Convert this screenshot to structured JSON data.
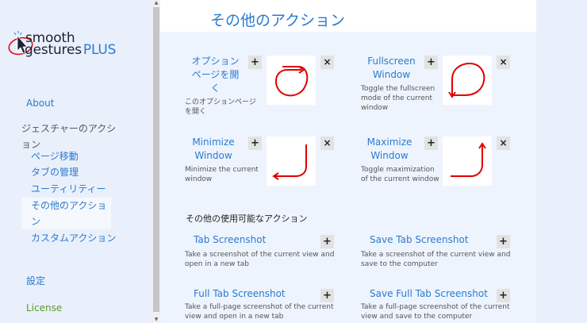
{
  "logo": {
    "line1": "smooth",
    "line2": "gestures",
    "plus": "PLUS"
  },
  "nav": {
    "about": "About",
    "gestures": "ジェスチャーのアクション",
    "sub": {
      "move": "ページ移動",
      "tabs": "タブの管理",
      "util": "ユーティリティー",
      "other": "その他のアクション",
      "custom": "カスタムアクション"
    },
    "settings": "設定",
    "license": "License"
  },
  "page": {
    "title": "その他のアクション"
  },
  "actions": {
    "options": {
      "label": "オプションページを開く",
      "desc": "このオプションページを開く",
      "add": "+",
      "remove": "×"
    },
    "fullscreen": {
      "label": "Fullscreen Window",
      "desc": "Toggle the fullscreen mode of the current window",
      "add": "+",
      "remove": "×"
    },
    "minimize": {
      "label": "Minimize Window",
      "desc": "Minimize the current window",
      "add": "+",
      "remove": "×"
    },
    "maximize": {
      "label": "Maximize Window",
      "desc": "Toggle maximization of the current window",
      "add": "+",
      "remove": "×"
    }
  },
  "available": {
    "title": "その他の使用可能なアクション",
    "items": [
      {
        "label": "Tab Screenshot",
        "desc": "Take a screenshot of the current view and open in a new tab",
        "add": "+"
      },
      {
        "label": "Save Tab Screenshot",
        "desc": "Take a screenshot of the current view and save to the computer",
        "add": "+"
      },
      {
        "label": "Full Tab Screenshot",
        "desc": "Take a full-page screenshot of the current view and open in a new tab",
        "add": "+"
      },
      {
        "label": "Save Full Tab Screenshot",
        "desc": "Take a full-page screenshot of the current view and save to the computer",
        "add": "+"
      }
    ]
  },
  "colors": {
    "accent": "#2a7ad0",
    "gesture": "#e00000"
  },
  "scrollbar": {
    "up": "▲",
    "down": "▼"
  }
}
